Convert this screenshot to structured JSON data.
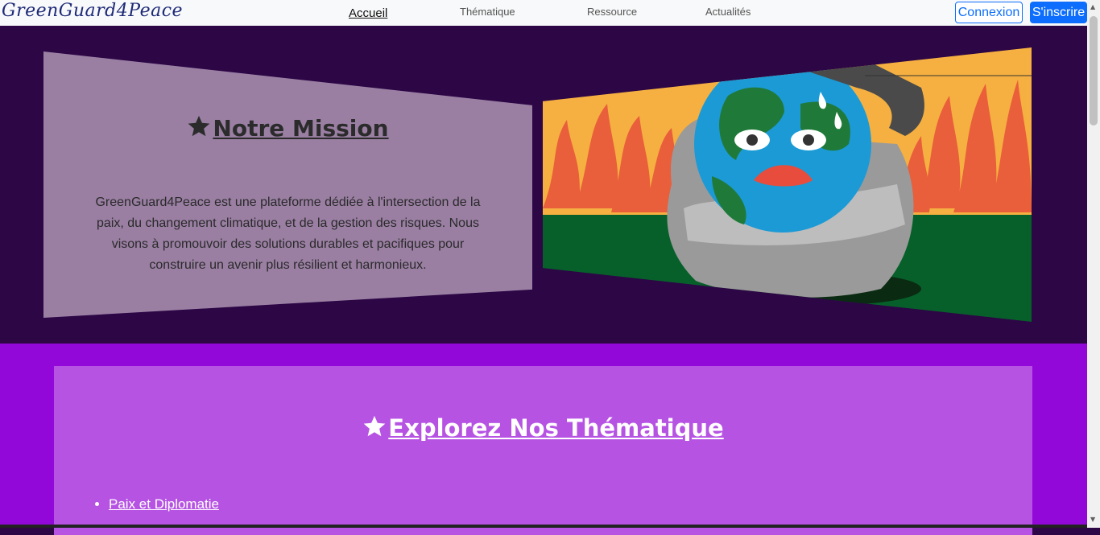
{
  "navbar": {
    "brand": "GreenGuard4Peace",
    "links": [
      "Accueil",
      "Thématique",
      "Ressource",
      "Actualités"
    ],
    "login_label": "Connexion",
    "signup_label": "S'inscrire"
  },
  "mission": {
    "title": "Notre Mission",
    "text": "GreenGuard4Peace est une plateforme dédiée à l'intersection de la paix, du changement climatique, et de la gestion des risques. Nous visons à promouvoir des solutions durables et pacifiques pour construire un avenir plus résilient et harmonieux."
  },
  "themes": {
    "title": "Explorez Nos Thématique",
    "items": [
      "Paix et Diplomatie"
    ]
  },
  "colors": {
    "page_bg": "#2c0645",
    "mission_panel": "#9a7fa3",
    "themes_bg": "#9208d9",
    "themes_panel": "#b653e3",
    "primary": "#0d6efd"
  }
}
